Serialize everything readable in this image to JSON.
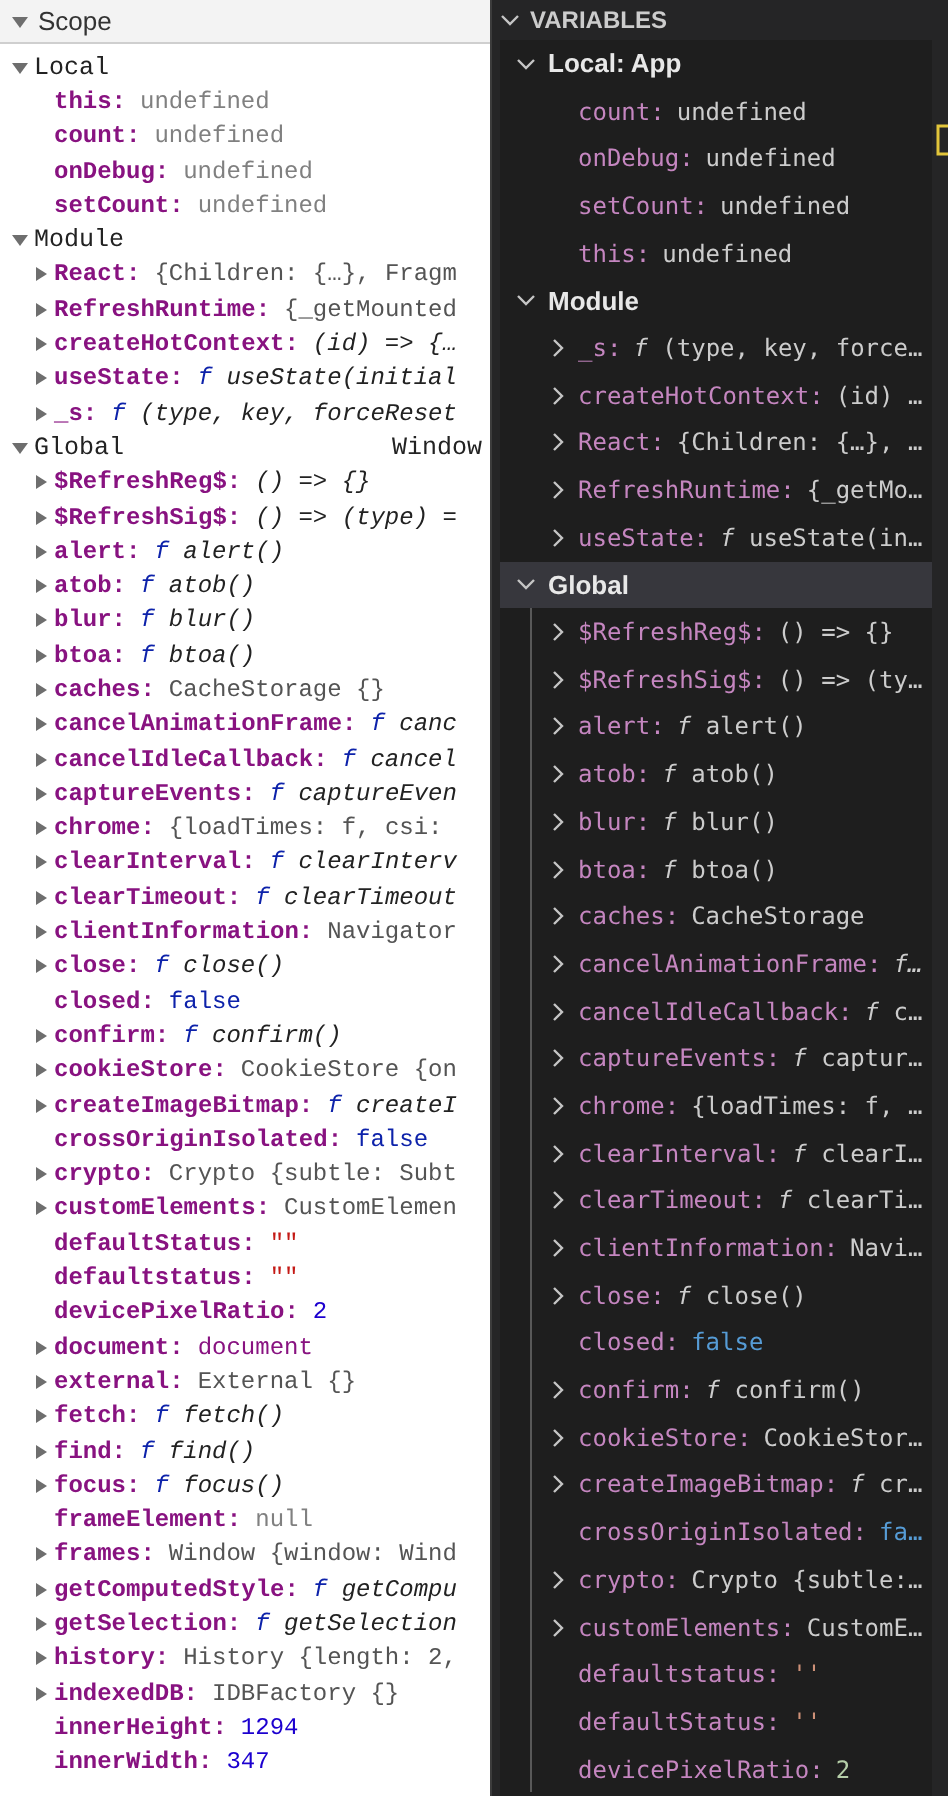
{
  "scope_panel": {
    "title": "Scope",
    "expanded": true,
    "sections": [
      {
        "title": "Local",
        "expanded": true,
        "items": [
          {
            "name": "this:",
            "expandable": false,
            "kind": "undefined",
            "value": "undefined"
          },
          {
            "name": "count:",
            "expandable": false,
            "kind": "undefined",
            "value": "undefined"
          },
          {
            "name": "onDebug:",
            "expandable": false,
            "kind": "undefined",
            "value": "undefined"
          },
          {
            "name": "setCount:",
            "expandable": false,
            "kind": "undefined",
            "value": "undefined"
          }
        ]
      },
      {
        "title": "Module",
        "expanded": true,
        "items": [
          {
            "name": "React:",
            "expandable": true,
            "kind": "object",
            "value": "{Children: {…}, Fragm"
          },
          {
            "name": "RefreshRuntime:",
            "expandable": true,
            "kind": "object",
            "value": "{_getMounted"
          },
          {
            "name": "createHotContext:",
            "expandable": true,
            "kind": "function",
            "value": "(id) => {…"
          },
          {
            "name": "useState:",
            "expandable": true,
            "kind": "function",
            "prefix": "f",
            "value": "useState(initial"
          },
          {
            "name": "_s:",
            "expandable": true,
            "kind": "function",
            "prefix": "f",
            "value": "(type, key, forceReset"
          }
        ]
      },
      {
        "title": "Global",
        "scope_value": "Window",
        "expanded": true,
        "items": [
          {
            "name": "$RefreshReg$:",
            "expandable": true,
            "kind": "function",
            "value": "() => {}"
          },
          {
            "name": "$RefreshSig$:",
            "expandable": true,
            "kind": "function",
            "value": "() => (type) ="
          },
          {
            "name": "alert:",
            "expandable": true,
            "kind": "function",
            "prefix": "f",
            "value": "alert()"
          },
          {
            "name": "atob:",
            "expandable": true,
            "kind": "function",
            "prefix": "f",
            "value": "atob()"
          },
          {
            "name": "blur:",
            "expandable": true,
            "kind": "function",
            "prefix": "f",
            "value": "blur()"
          },
          {
            "name": "btoa:",
            "expandable": true,
            "kind": "function",
            "prefix": "f",
            "value": "btoa()"
          },
          {
            "name": "caches:",
            "expandable": true,
            "kind": "object",
            "value": "CacheStorage {}"
          },
          {
            "name": "cancelAnimationFrame:",
            "expandable": true,
            "kind": "function",
            "prefix": "f",
            "value": "canc"
          },
          {
            "name": "cancelIdleCallback:",
            "expandable": true,
            "kind": "function",
            "prefix": "f",
            "value": "cancel"
          },
          {
            "name": "captureEvents:",
            "expandable": true,
            "kind": "function",
            "prefix": "f",
            "value": "captureEven"
          },
          {
            "name": "chrome:",
            "expandable": true,
            "kind": "object",
            "value": "{loadTimes: f, csi:"
          },
          {
            "name": "clearInterval:",
            "expandable": true,
            "kind": "function",
            "prefix": "f",
            "value": "clearInterv"
          },
          {
            "name": "clearTimeout:",
            "expandable": true,
            "kind": "function",
            "prefix": "f",
            "value": "clearTimeout"
          },
          {
            "name": "clientInformation:",
            "expandable": true,
            "kind": "object",
            "value": "Navigator"
          },
          {
            "name": "close:",
            "expandable": true,
            "kind": "function",
            "prefix": "f",
            "value": "close()"
          },
          {
            "name": "closed:",
            "expandable": false,
            "kind": "boolean",
            "value": "false"
          },
          {
            "name": "confirm:",
            "expandable": true,
            "kind": "function",
            "prefix": "f",
            "value": "confirm()"
          },
          {
            "name": "cookieStore:",
            "expandable": true,
            "kind": "object",
            "value": "CookieStore {on"
          },
          {
            "name": "createImageBitmap:",
            "expandable": true,
            "kind": "function",
            "prefix": "f",
            "value": "createI"
          },
          {
            "name": "crossOriginIsolated:",
            "expandable": false,
            "kind": "boolean",
            "value": "false"
          },
          {
            "name": "crypto:",
            "expandable": true,
            "kind": "object",
            "value": "Crypto {subtle: Subt"
          },
          {
            "name": "customElements:",
            "expandable": true,
            "kind": "object",
            "value": "CustomElemen"
          },
          {
            "name": "defaultStatus:",
            "expandable": false,
            "kind": "string",
            "value": "\"\""
          },
          {
            "name": "defaultstatus:",
            "expandable": false,
            "kind": "string",
            "value": "\"\""
          },
          {
            "name": "devicePixelRatio:",
            "expandable": false,
            "kind": "number",
            "value": "2"
          },
          {
            "name": "document:",
            "expandable": true,
            "kind": "node",
            "value": "document"
          },
          {
            "name": "external:",
            "expandable": true,
            "kind": "object",
            "value": "External {}"
          },
          {
            "name": "fetch:",
            "expandable": true,
            "kind": "function",
            "prefix": "f",
            "value": "fetch()"
          },
          {
            "name": "find:",
            "expandable": true,
            "kind": "function",
            "prefix": "f",
            "value": "find()"
          },
          {
            "name": "focus:",
            "expandable": true,
            "kind": "function",
            "prefix": "f",
            "value": "focus()"
          },
          {
            "name": "frameElement:",
            "expandable": false,
            "kind": "null",
            "value": "null"
          },
          {
            "name": "frames:",
            "expandable": true,
            "kind": "object",
            "value": "Window {window: Wind"
          },
          {
            "name": "getComputedStyle:",
            "expandable": true,
            "kind": "function",
            "prefix": "f",
            "value": "getCompu"
          },
          {
            "name": "getSelection:",
            "expandable": true,
            "kind": "function",
            "prefix": "f",
            "value": "getSelection"
          },
          {
            "name": "history:",
            "expandable": true,
            "kind": "object",
            "value": "History {length: 2,"
          },
          {
            "name": "indexedDB:",
            "expandable": true,
            "kind": "object",
            "value": "IDBFactory {}"
          },
          {
            "name": "innerHeight:",
            "expandable": false,
            "kind": "number",
            "value": "1294"
          },
          {
            "name": "innerWidth:",
            "expandable": false,
            "kind": "number",
            "value": "347"
          }
        ]
      }
    ]
  },
  "variables_panel": {
    "title": "VARIABLES",
    "expanded": true,
    "sections": [
      {
        "title": "Local: App",
        "expanded": true,
        "selected": false,
        "items": [
          {
            "name": "count:",
            "expandable": false,
            "kind": "undefined",
            "value": "undefined"
          },
          {
            "name": "onDebug:",
            "expandable": false,
            "kind": "undefined",
            "value": "undefined"
          },
          {
            "name": "setCount:",
            "expandable": false,
            "kind": "undefined",
            "value": "undefined"
          },
          {
            "name": "this:",
            "expandable": false,
            "kind": "undefined",
            "value": "undefined"
          }
        ]
      },
      {
        "title": "Module",
        "expanded": true,
        "selected": false,
        "items": [
          {
            "name": "_s:",
            "expandable": true,
            "kind": "function",
            "prefix": "f",
            "value": "(type, key, force…"
          },
          {
            "name": "createHotContext:",
            "expandable": true,
            "kind": "function",
            "value": "(id) …"
          },
          {
            "name": "React:",
            "expandable": true,
            "kind": "object",
            "value": "{Children: {…}, …"
          },
          {
            "name": "RefreshRuntime:",
            "expandable": true,
            "kind": "object",
            "value": "{_getMo…"
          },
          {
            "name": "useState:",
            "expandable": true,
            "kind": "function",
            "prefix": "f",
            "value": "useState(in…"
          }
        ]
      },
      {
        "title": "Global",
        "expanded": true,
        "selected": true,
        "items": [
          {
            "name": "$RefreshReg$:",
            "expandable": true,
            "kind": "function",
            "value": "() => {}"
          },
          {
            "name": "$RefreshSig$:",
            "expandable": true,
            "kind": "function",
            "value": "() => (ty…"
          },
          {
            "name": "alert:",
            "expandable": true,
            "kind": "function",
            "prefix": "f",
            "value": "alert()"
          },
          {
            "name": "atob:",
            "expandable": true,
            "kind": "function",
            "prefix": "f",
            "value": "atob()"
          },
          {
            "name": "blur:",
            "expandable": true,
            "kind": "function",
            "prefix": "f",
            "value": "blur()"
          },
          {
            "name": "btoa:",
            "expandable": true,
            "kind": "function",
            "prefix": "f",
            "value": "btoa()"
          },
          {
            "name": "caches:",
            "expandable": true,
            "kind": "object",
            "value": "CacheStorage"
          },
          {
            "name": "cancelAnimationFrame:",
            "expandable": true,
            "kind": "function",
            "prefix": "f…"
          },
          {
            "name": "cancelIdleCallback:",
            "expandable": true,
            "kind": "function",
            "prefix": "f",
            "value": "c…"
          },
          {
            "name": "captureEvents:",
            "expandable": true,
            "kind": "function",
            "prefix": "f",
            "value": "captur…"
          },
          {
            "name": "chrome:",
            "expandable": true,
            "kind": "object",
            "value": "{loadTimes: f, …"
          },
          {
            "name": "clearInterval:",
            "expandable": true,
            "kind": "function",
            "prefix": "f",
            "value": "clearI…"
          },
          {
            "name": "clearTimeout:",
            "expandable": true,
            "kind": "function",
            "prefix": "f",
            "value": "clearTi…"
          },
          {
            "name": "clientInformation:",
            "expandable": true,
            "kind": "object",
            "value": "Navi…"
          },
          {
            "name": "close:",
            "expandable": true,
            "kind": "function",
            "prefix": "f",
            "value": "close()"
          },
          {
            "name": "closed:",
            "expandable": false,
            "kind": "boolean",
            "value": "false"
          },
          {
            "name": "confirm:",
            "expandable": true,
            "kind": "function",
            "prefix": "f",
            "value": "confirm()"
          },
          {
            "name": "cookieStore:",
            "expandable": true,
            "kind": "object",
            "value": "CookieStor…"
          },
          {
            "name": "createImageBitmap:",
            "expandable": true,
            "kind": "function",
            "prefix": "f",
            "value": "cr…"
          },
          {
            "name": "crossOriginIsolated:",
            "expandable": false,
            "kind": "boolean",
            "value": "fa…"
          },
          {
            "name": "crypto:",
            "expandable": true,
            "kind": "object",
            "value": "Crypto {subtle:…"
          },
          {
            "name": "customElements:",
            "expandable": true,
            "kind": "object",
            "value": "CustomE…"
          },
          {
            "name": "defaultstatus:",
            "expandable": false,
            "kind": "string",
            "value": "''"
          },
          {
            "name": "defaultStatus:",
            "expandable": false,
            "kind": "string",
            "value": "''"
          },
          {
            "name": "devicePixelRatio:",
            "expandable": false,
            "kind": "number",
            "value": "2"
          }
        ]
      }
    ]
  }
}
